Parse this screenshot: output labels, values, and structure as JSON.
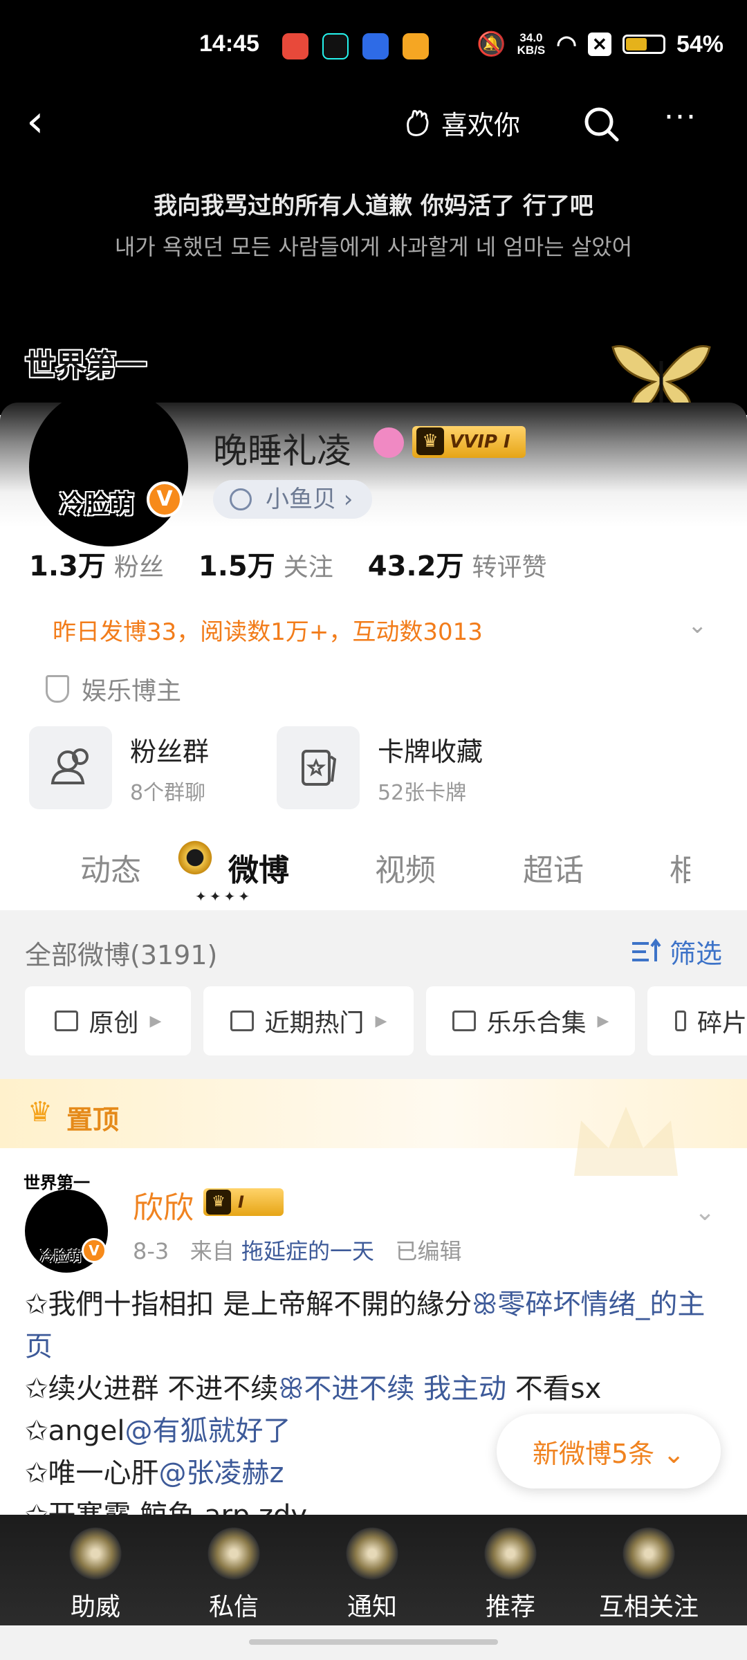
{
  "status": {
    "time": "14:45",
    "speed_top": "34.0",
    "speed_unit": "KB/S",
    "battery": "54%",
    "battery_level": 0.54
  },
  "nav": {
    "back": "‹",
    "like_label": "喜欢你",
    "more": "···"
  },
  "banner": {
    "cn": "我向我骂过的所有人道歉 你妈活了 行了吧",
    "kr": "내가 욕했던 모든 사람들에게 사과할게 네 엄마는 살았어",
    "world_first": "世界第一"
  },
  "profile": {
    "name": "晚睡礼凌",
    "avatar_tag": "冷脸萌",
    "verify": "V",
    "vvip": "VVIP I",
    "fish_label": "小鱼贝 ›",
    "stats": [
      {
        "value": "1.3万",
        "label": "粉丝"
      },
      {
        "value": "1.5万",
        "label": "关注"
      },
      {
        "value": "43.2万",
        "label": "转评赞"
      }
    ],
    "summary": "昨日发博33，阅读数1万+，互动数3013",
    "category": "娱乐博主",
    "tiles": [
      {
        "title": "粉丝群",
        "sub": "8个群聊"
      },
      {
        "title": "卡牌收藏",
        "sub": "52张卡牌"
      }
    ]
  },
  "tabs": [
    "动态",
    "微博",
    "视频",
    "超话",
    "相"
  ],
  "active_tab": "微博",
  "feed": {
    "all_count": "全部微博(3191)",
    "filter": "筛选",
    "chips": [
      "原创",
      "近期热门",
      "乐乐合集",
      "碎片"
    ]
  },
  "pinned": {
    "label": "置顶"
  },
  "post": {
    "av_top": "世界第一",
    "av_bot": "冷脸萌",
    "name": "欣欣",
    "badge": "I",
    "date": "8-3",
    "from": "来自",
    "source": "拖延症的一天",
    "edited": "已编辑",
    "lines": [
      {
        "pre": "✩我們十指相扣 是上帝解不開的緣分",
        "link": "ꕥ零碎坏情绪_的主页",
        "post": ""
      },
      {
        "pre": "✩续火进群 不进不续",
        "link": "ꕥ不进不续 我主动",
        "post": " 不看sx"
      },
      {
        "pre": "✩angel",
        "link": "@有狐就好了",
        "post": ""
      },
      {
        "pre": "✩唯一心肝",
        "link": "@张凌赫z",
        "post": ""
      },
      {
        "pre": "✩开寒露 鲸鱼 arp zdy",
        "link": "",
        "post": ""
      }
    ]
  },
  "new_posts": "新微博5条 ⌄",
  "bottom_nav": [
    "助威",
    "私信",
    "通知",
    "推荐",
    "互相关注"
  ],
  "colors": {
    "accent_orange": "#f08320",
    "link_blue": "#3d5a99",
    "filter_blue": "#3d73c8"
  }
}
